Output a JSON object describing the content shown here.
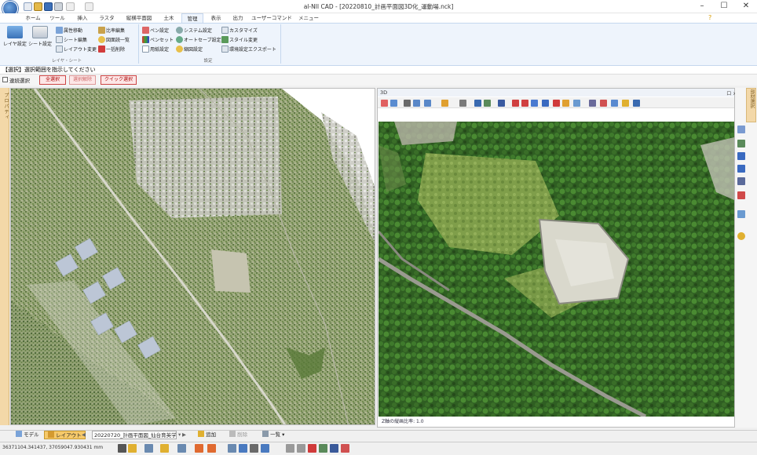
{
  "window": {
    "title": "al-NII CAD - [20220810_計画平面図3D化_運動場.nck]",
    "controls": [
      "–",
      "☐",
      "✕"
    ]
  },
  "quick_access_icons": [
    "new-file-icon",
    "open-folder-icon",
    "save-icon",
    "print-icon",
    "undo-icon",
    "redo-icon"
  ],
  "ribbon_tabs": [
    "ホーム",
    "ツール",
    "挿入",
    "ラスタ",
    "縦横平面図",
    "土木",
    "管理",
    "表示",
    "出力",
    "ユーザーコマンド",
    "メニュー"
  ],
  "active_tab": "管理",
  "ribbon": {
    "layer_group": {
      "label": "レイヤ・シート",
      "big_buttons": [
        "レイヤ設定",
        "シート設定"
      ],
      "col1": [
        "属性移動",
        "シート編集",
        "レイアウト変更"
      ],
      "col2": [
        "比率編集",
        "図面読一覧",
        "一括削除"
      ]
    },
    "settings_group": {
      "label": "設定",
      "col1": [
        "ペン設定",
        "ペンセット",
        "用紙設定"
      ],
      "col2": [
        "システム設定",
        "オートセーブ設定",
        "縮図設定"
      ],
      "col3": [
        "カスタマイズ",
        "スタイル変更",
        "環境設定エクスポート"
      ]
    }
  },
  "prompt": "【選択】選択範囲を指示してください",
  "selection_bar": {
    "continuous_label": "連続選択",
    "buttons": [
      "全選択",
      "選択解除",
      "クイック選択"
    ]
  },
  "left_strip_label": "プロパティ",
  "right_pane": {
    "title": "3D",
    "close": "ロ x",
    "status": "Z軸の縦画比率: 1.0"
  },
  "right_strip_label": "部材選択",
  "bottom_tabs": {
    "model": "モデル",
    "layout": "レイアウト",
    "sheet": "20220720_計画平面図_仙台育英学",
    "add": "追加",
    "delete": "削除",
    "list": "一覧"
  },
  "status_bar": {
    "coords": "36371104.341437, 37059047.930431 mm"
  },
  "colors": {
    "accent": "#2f6fc4",
    "ribbon_bg": "#eef4fc",
    "layout_tab_bg": "#f6c96a",
    "left_strip": "#f3d8a8"
  }
}
